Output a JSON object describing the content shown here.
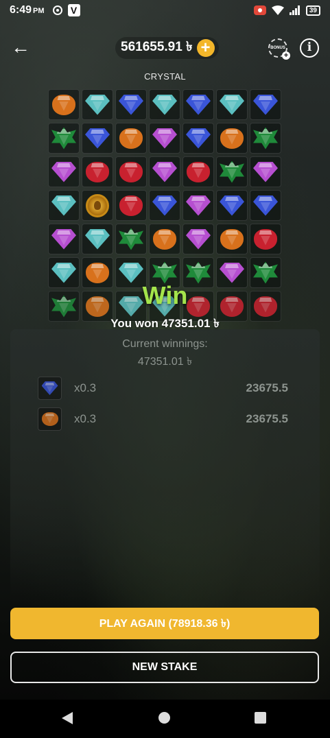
{
  "status_bar": {
    "time": "6:49",
    "ampm": "PM",
    "battery": "39"
  },
  "header": {
    "balance": "561655.91 ৳",
    "plus_label": "+",
    "bonus_label": "BONUS",
    "info_label": "i"
  },
  "game": {
    "title": "CRYSTAL",
    "colors": {
      "orange": "#d8711c",
      "cyan": "#5bbfc0",
      "blue": "#3a55d8",
      "green": "#1f8a3a",
      "purple": "#b64fd0",
      "red": "#c8212f"
    },
    "grid": [
      [
        "orange",
        "cyan",
        "blue",
        "cyan",
        "blue",
        "cyan",
        "blue"
      ],
      [
        "green",
        "blue",
        "orange",
        "purple",
        "blue",
        "orange",
        "green"
      ],
      [
        "purple",
        "red",
        "red",
        "purple",
        "red",
        "green",
        "purple"
      ],
      [
        "cyan",
        "coin",
        "red",
        "blue",
        "purple",
        "blue",
        "blue"
      ],
      [
        "purple",
        "cyan",
        "green",
        "orange",
        "purple",
        "orange",
        "red"
      ],
      [
        "cyan",
        "orange",
        "cyan",
        "green",
        "green",
        "purple",
        "green"
      ],
      [
        "green",
        "orange",
        "cyan",
        "cyan",
        "red",
        "red",
        "red"
      ]
    ]
  },
  "win": {
    "title": "Win",
    "message": "You won 47351.01 ৳"
  },
  "results": {
    "current_winnings_label": "Current winnings:",
    "current_winnings_value": "47351.01 ৳",
    "rows": [
      {
        "gem": "blue",
        "multiplier": "x0.3",
        "amount": "23675.5"
      },
      {
        "gem": "orange",
        "multiplier": "x0.3",
        "amount": "23675.5"
      }
    ]
  },
  "actions": {
    "play_again": "PLAY AGAIN (78918.36 ৳)",
    "new_stake": "NEW STAKE"
  }
}
